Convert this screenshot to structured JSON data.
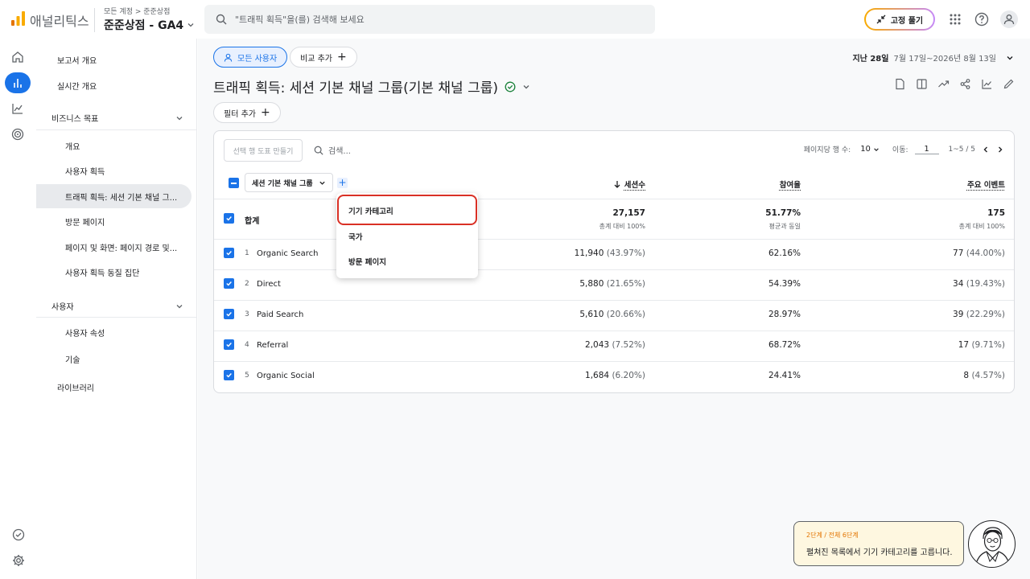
{
  "header": {
    "app_name": "애널리틱스",
    "breadcrumb": "모든 계정 > 준준상점",
    "property": "준준상점 - GA4",
    "search_placeholder": "\"트래픽 획득\"을(를) 검색해 보세요",
    "pin_label": "고정 풀기"
  },
  "sidebar": {
    "items": [
      {
        "label": "보고서 개요"
      },
      {
        "label": "실시간 개요"
      },
      {
        "label": "비즈니스 목표"
      },
      {
        "label": "개요"
      },
      {
        "label": "사용자 획득"
      },
      {
        "label": "트래픽 획득: 세션 기본 채널 그..."
      },
      {
        "label": "방문 페이지"
      },
      {
        "label": "페이지 및 화면: 페이지 경로 및..."
      },
      {
        "label": "사용자 획득 동질 집단"
      },
      {
        "label": "사용자"
      },
      {
        "label": "사용자 속성"
      },
      {
        "label": "기술"
      },
      {
        "label": "라이브러리"
      }
    ]
  },
  "main": {
    "segment_chip": "모든 사용자",
    "compare_chip": "비교 추가",
    "date_label": "지난 28일",
    "date_range": "7월 17일~2026년 8월 13일",
    "title": "트래픽 획득: 세션 기본 채널 그룹(기본 채널 그룹)",
    "filter_chip": "필터 추가"
  },
  "table": {
    "chart_button": "선택 행 도표 만들기",
    "search_placeholder": "검색...",
    "rows_per_page_label": "페이지당 행 수:",
    "rows_per_page": "10",
    "goto_label": "이동:",
    "goto_value": "1",
    "range": "1~5 / 5",
    "dimension": "세션 기본 채널 그룹",
    "columns": [
      "세션수",
      "참여율",
      "주요 이벤트"
    ],
    "total": {
      "label": "합계",
      "sessions": "27,157",
      "sessions_sub": "총계 대비 100%",
      "engagement": "51.77%",
      "engagement_sub": "평균과 동일",
      "events": "175",
      "events_sub": "총계 대비 100%"
    },
    "rows": [
      {
        "n": "1",
        "channel": "Organic Search",
        "sessions": "11,940",
        "sessions_pct": "(43.97%)",
        "engagement": "62.16%",
        "events": "77",
        "events_pct": "(44.00%)"
      },
      {
        "n": "2",
        "channel": "Direct",
        "sessions": "5,880",
        "sessions_pct": "(21.65%)",
        "engagement": "54.39%",
        "events": "34",
        "events_pct": "(19.43%)"
      },
      {
        "n": "3",
        "channel": "Paid Search",
        "sessions": "5,610",
        "sessions_pct": "(20.66%)",
        "engagement": "28.97%",
        "events": "39",
        "events_pct": "(22.29%)"
      },
      {
        "n": "4",
        "channel": "Referral",
        "sessions": "2,043",
        "sessions_pct": "(7.52%)",
        "engagement": "68.72%",
        "events": "17",
        "events_pct": "(9.71%)"
      },
      {
        "n": "5",
        "channel": "Organic Social",
        "sessions": "1,684",
        "sessions_pct": "(6.20%)",
        "engagement": "24.41%",
        "events": "8",
        "events_pct": "(4.57%)"
      }
    ]
  },
  "dropdown": {
    "items": [
      {
        "label": "기기 카테고리"
      },
      {
        "label": "국가"
      },
      {
        "label": "방문 페이지"
      }
    ]
  },
  "tutorial": {
    "step": "2단계 / 전체 6단계",
    "text": "펼쳐진 목록에서 기기 카테고리를 고릅니다."
  },
  "colors": {
    "accent": "#1a73e8",
    "highlight": "#d93025",
    "logo_orange": "#f9ab00",
    "logo_dark": "#e37400"
  }
}
